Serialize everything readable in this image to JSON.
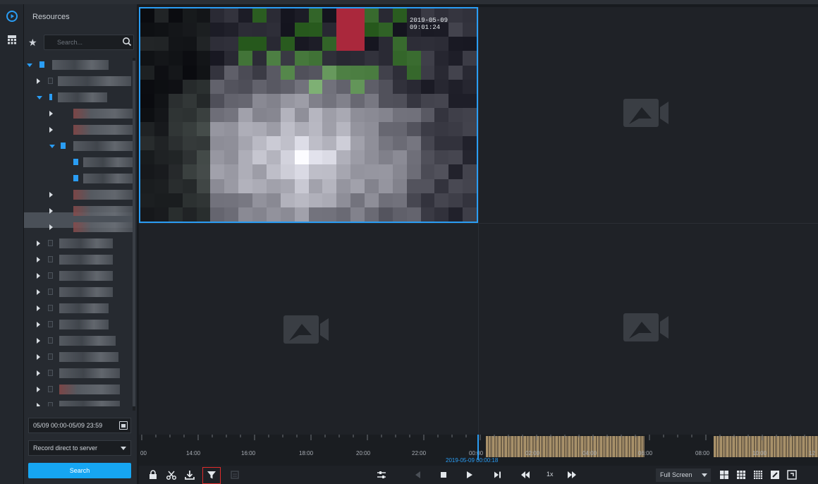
{
  "sidebar": {
    "title": "Resources",
    "search_placeholder": "Search..."
  },
  "filters": {
    "date_range": "05/09 00:00-05/09 23:59",
    "record_source": "Record direct to server",
    "search_button": "Search"
  },
  "video": {
    "timestamp_overlay": "2019-05-09 09:01:24"
  },
  "timeline": {
    "labels": [
      "00",
      "14:00",
      "16:00",
      "18:00",
      "20:00",
      "22:00",
      "00:00",
      "02:00",
      "04:00",
      "06:00",
      "08:00",
      "10:00",
      "12"
    ],
    "current_time": "2019-05-09 00:00:18"
  },
  "toolbar": {
    "speed_label": "1x",
    "fullscreen_label": "Full Screen"
  },
  "icons": [
    "playback-icon",
    "grid-icon",
    "star-icon",
    "search-icon",
    "calendar-icon",
    "lock-icon",
    "scissors-icon",
    "download-icon",
    "filter-icon",
    "tag-icon",
    "settings-icon",
    "prev-frame-icon",
    "stop-icon",
    "play-icon",
    "next-frame-icon",
    "slow-icon",
    "fast-icon",
    "layout-4-icon",
    "layout-9-icon",
    "layout-16-icon",
    "custom-layout-icon",
    "fullscreen-icon"
  ],
  "colors": {
    "accent": "#2a9df4",
    "search_button": "#16a6f2",
    "highlight_box": "#e02b2b",
    "record_bar": "#a8916a"
  }
}
